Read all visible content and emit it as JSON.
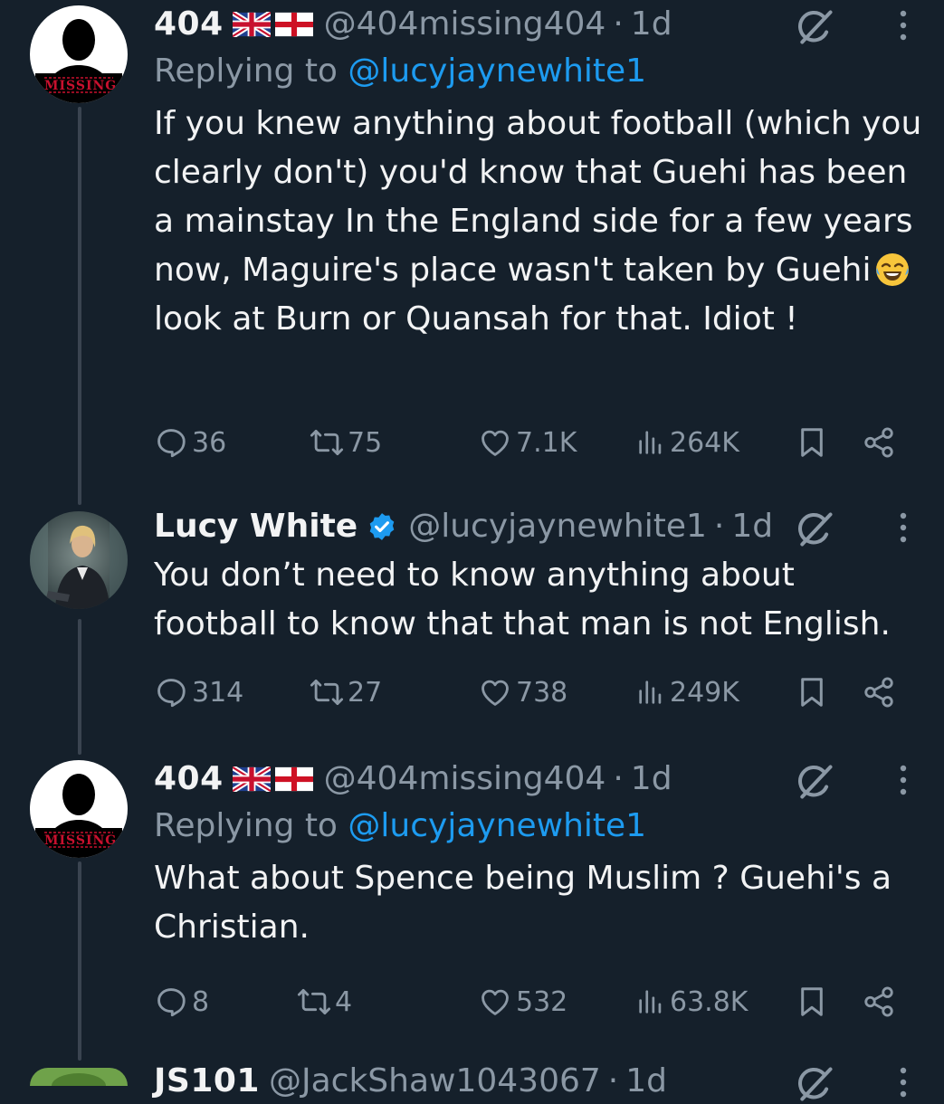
{
  "tweets": [
    {
      "name": "404",
      "handle": "@404missing404",
      "time": "1d",
      "avatar_label": "MISSING",
      "replying_prefix": "Replying to ",
      "replying_to": "@lucyjaynewhite1",
      "text_before_emoji": "If you knew anything about football (which you clearly don't) you'd know that Guehi has been a mainstay In the England side for a few years now, Maguire's place wasn't taken by Guehi",
      "text_after_emoji": "look at Burn or Quansah for that. Idiot !",
      "emoji": "face-with-tears-of-joy",
      "replies": "36",
      "reposts": "75",
      "likes": "7.1K",
      "views": "264K"
    },
    {
      "name": "Lucy White",
      "handle": "@lucyjaynewhite1",
      "time": "1d",
      "verified": true,
      "text": "You don’t need to know anything about football to know that that man is not English.",
      "replies": "314",
      "reposts": "27",
      "likes": "738",
      "views": "249K"
    },
    {
      "name": "404",
      "handle": "@404missing404",
      "time": "1d",
      "avatar_label": "MISSING",
      "replying_prefix": "Replying to ",
      "replying_to": "@lucyjaynewhite1",
      "text": "What about Spence being Muslim ? Guehi's a Christian.",
      "replies": "8",
      "reposts": "4",
      "likes": "532",
      "views": "63.8K"
    },
    {
      "name": "JS101",
      "handle": "@JackShaw1043067",
      "time": "1d"
    }
  ],
  "colors": {
    "background": "#15202b",
    "text": "#e7e9ea",
    "muted": "#8b98a5",
    "link": "#1d9bf0",
    "verified": "#1d9bf0",
    "thread_line": "#3a4450"
  },
  "icons": {
    "reply": "speech-bubble-icon",
    "repost": "repost-arrows-icon",
    "like": "heart-icon",
    "views": "bar-chart-icon",
    "bookmark": "bookmark-icon",
    "share": "share-nodes-icon",
    "grok": "grok-slash-icon",
    "more": "vertical-ellipsis-icon"
  }
}
